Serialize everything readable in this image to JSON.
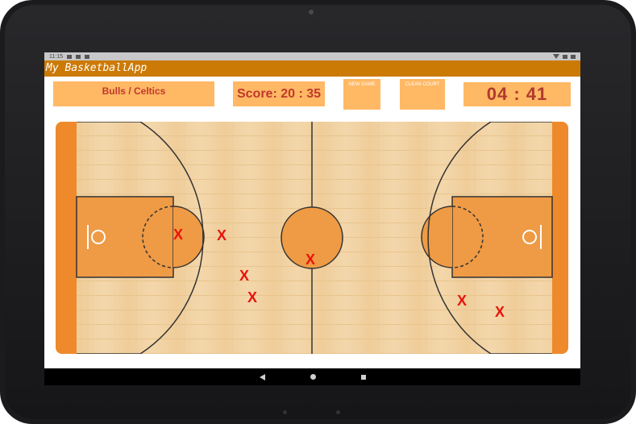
{
  "status_bar": {
    "time": "11:15"
  },
  "app": {
    "title": "My BasketballApp"
  },
  "controls": {
    "teams_label": "Bulls / Celtics",
    "score_label": "Score: 20 : 35",
    "new_game_label": "NEW GAME",
    "clean_court_label": "CLEAN COURT",
    "timer": "04 : 41"
  },
  "court": {
    "marks": [
      {
        "label": "X"
      },
      {
        "label": "X"
      },
      {
        "label": "X"
      },
      {
        "label": "X"
      },
      {
        "label": "X"
      },
      {
        "label": "X"
      },
      {
        "label": "X"
      }
    ]
  },
  "colors": {
    "accent": "#cc7a06",
    "button_fill": "#ffb864",
    "score_text": "#c0392b",
    "mark": "#e8140c",
    "court_wood": "#f0cf9e",
    "paint": "#ef9a44"
  },
  "icons": {
    "nav_back": "back-triangle-icon",
    "nav_home": "home-circle-icon",
    "nav_recent": "recent-square-icon"
  }
}
